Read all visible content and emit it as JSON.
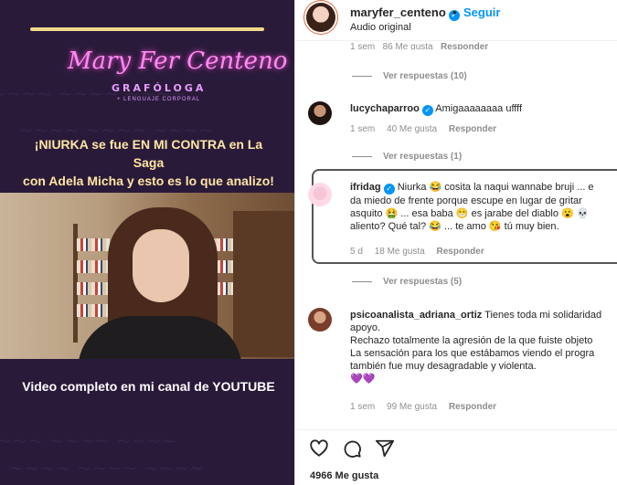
{
  "media": {
    "logo_script": "Mary Fer Centeno",
    "logo_title": "GRAFÓLOGA",
    "logo_subtitle": "+ LENGUAJE CORPORAL",
    "headline_line1": "¡NIURKA se fue EN MI CONTRA en La Saga",
    "headline_line2": "con Adela Micha y esto es lo que analizo!",
    "cta": "Video completo en mi canal de YOUTUBE"
  },
  "header": {
    "username": "maryfer_centeno",
    "separator": "•",
    "follow_label": "Seguir",
    "audio": "Audio original"
  },
  "top_partial": {
    "time": "1 sem",
    "likes": "86 Me gusta",
    "reply": "Responder"
  },
  "view_replies": [
    "Ver respuestas (10)",
    "Ver respuestas (1)",
    "Ver respuestas (5)"
  ],
  "comments": [
    {
      "username": "lucychaparroo",
      "text": "Amigaaaaaaaa uffff",
      "time": "1 sem",
      "likes": "40 Me gusta",
      "reply": "Responder"
    },
    {
      "username": "ifridag",
      "lines": [
        "Niurka 😂 cosita la naqui wannabe bruji ... e",
        "da miedo de frente porque escupe en lugar de gritar",
        "asquito 🤮 ... esa baba 😁 es jarabe del diablo 😮 💀",
        "aliento? Qué tal? 😂 ... te amo 😘 tú muy bien."
      ],
      "time": "5 d",
      "likes": "18 Me gusta",
      "reply": "Responder"
    },
    {
      "username": "psicoanalista_adriana_ortiz",
      "lines": [
        "Tienes toda mi solidaridad",
        "apoyo.",
        "Rechazo totalmente la agresión de la que fuiste objeto",
        "La sensación para los que estábamos viendo el progra",
        "también fue muy desagradable y violenta.",
        "💜💜"
      ],
      "time": "1 sem",
      "likes": "99 Me gusta",
      "reply": "Responder"
    }
  ],
  "actions": {
    "icons": [
      "heart-icon",
      "comment-icon",
      "share-icon"
    ]
  },
  "likes_count": "4966 Me gusta",
  "colors": {
    "accent": "#0095f6",
    "media_bg": "#2a1a3a",
    "headline": "#ffe6a3",
    "neon": "#ff8bf0"
  }
}
